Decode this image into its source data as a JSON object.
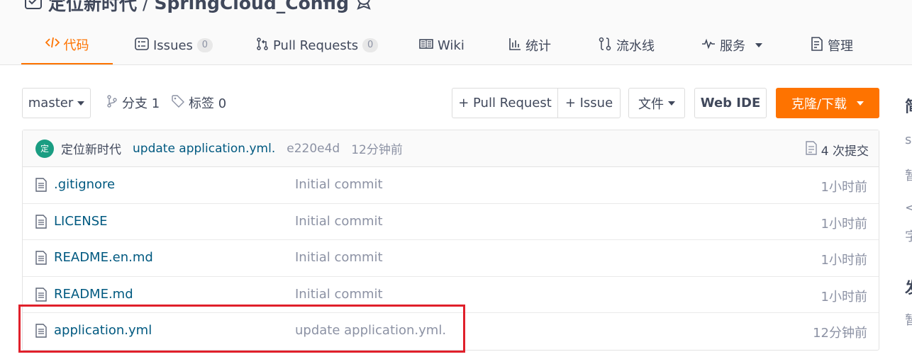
{
  "header": {
    "repo_owner": "定位新时代",
    "separator": "/",
    "repo_name": "SpringCloud_Config",
    "tabs": [
      {
        "label": "代码",
        "icon": "code-icon",
        "active": true
      },
      {
        "label": "Issues",
        "badge": "0",
        "icon": "issues-icon"
      },
      {
        "label": "Pull Requests",
        "badge": "0",
        "icon": "pull-request-icon"
      },
      {
        "label": "Wiki",
        "icon": "book-icon"
      },
      {
        "label": "统计",
        "icon": "chart-icon"
      },
      {
        "label": "流水线",
        "icon": "pipeline-icon"
      },
      {
        "label": "服务",
        "icon": "pulse-icon"
      },
      {
        "label": "管理",
        "icon": "settings-doc-icon"
      }
    ]
  },
  "toolbar": {
    "branch": "master",
    "branches_label": "分支 1",
    "tags_label": "标签 0",
    "pull_request_btn": "+ Pull Request",
    "issue_btn": "+ Issue",
    "file_btn": "文件",
    "web_ide_btn": "Web IDE",
    "clone_btn": "克隆/下载"
  },
  "commit": {
    "avatar_text": "定",
    "author": "定位新时代",
    "message": "update application.yml.",
    "hash": "e220e4d",
    "time": "12分钟前",
    "count_label": "4 次提交"
  },
  "files": [
    {
      "name": ".gitignore",
      "message": "Initial commit",
      "time": "1小时前"
    },
    {
      "name": "LICENSE",
      "message": "Initial commit",
      "time": "1小时前"
    },
    {
      "name": "README.en.md",
      "message": "Initial commit",
      "time": "1小时前"
    },
    {
      "name": "README.md",
      "message": "Initial commit",
      "time": "1小时前"
    },
    {
      "name": "application.yml",
      "message": "update application.yml.",
      "time": "12分钟前"
    }
  ],
  "sidebar_fragments": [
    "简",
    "s",
    "暂",
    "</",
    "字",
    "发",
    "暂"
  ],
  "colors": {
    "accent": "#fe7300",
    "link": "#005980",
    "highlight": "#e0202b",
    "avatar": "#1a9d82"
  }
}
